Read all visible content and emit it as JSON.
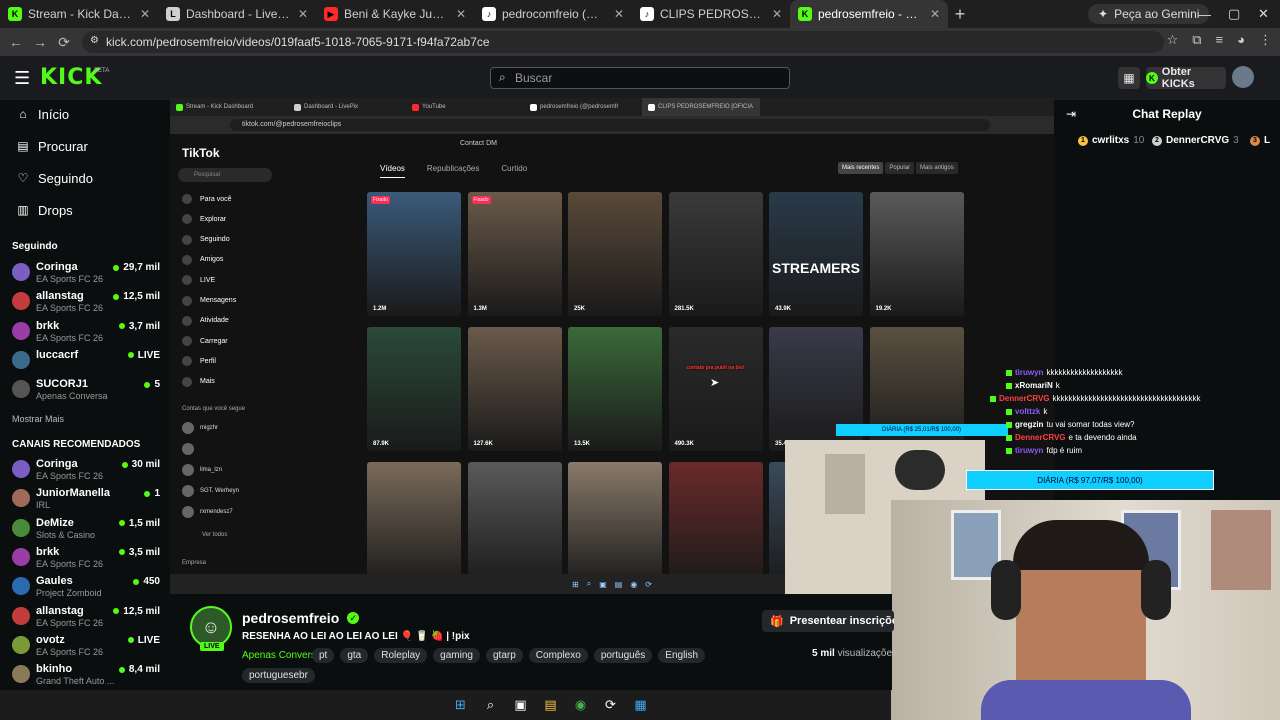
{
  "browser": {
    "tabs": [
      {
        "title": "Stream - Kick Dashboard",
        "fav": "K",
        "color": "#53fc18"
      },
      {
        "title": "Dashboard - LivePix",
        "fav": "L",
        "color": "#cfcfcf"
      },
      {
        "title": "Beni & Kayke Juan - \"Menor Pr",
        "fav": "▶",
        "color": "#ff2b2b"
      },
      {
        "title": "pedrocomfreio (@pedrocomfre",
        "fav": "♪",
        "color": "#ffffff"
      },
      {
        "title": "CLIPS PEDROSEMFREIO [OFICIA",
        "fav": "♪",
        "color": "#ffffff"
      },
      {
        "title": "pedrosemfreio - Watch the",
        "fav": "K",
        "color": "#53fc18"
      }
    ],
    "gemini_label": "Peça ao Gemini",
    "url": "kick.com/pedrosemfreio/videos/019faaf5-1018-7065-9171-f94fa72ab7ce"
  },
  "header": {
    "logo": "KICK",
    "beta": "BETA",
    "search_placeholder": "Buscar",
    "kicks_label": "Obter KICKs"
  },
  "sidebar": {
    "nav": [
      {
        "label": "Início",
        "icon": "⌂"
      },
      {
        "label": "Procurar",
        "icon": "▤"
      },
      {
        "label": "Seguindo",
        "icon": "♡"
      },
      {
        "label": "Drops",
        "icon": "▥"
      }
    ],
    "following_title": "Seguindo",
    "following": [
      {
        "name": "Coringa",
        "game": "EA Sports FC 26",
        "viewers": "29,7 mil",
        "color": "#7a5ec2"
      },
      {
        "name": "allanstag",
        "game": "EA Sports FC 26",
        "viewers": "12,5 mil",
        "color": "#c33b3b"
      },
      {
        "name": "brkk",
        "game": "EA Sports FC 26",
        "viewers": "3,7 mil",
        "color": "#9a3ca5"
      },
      {
        "name": "luccacrf",
        "game": "",
        "viewers": "LIVE",
        "color": "#3a6b8a"
      },
      {
        "name": "SUCORJ1",
        "game": "Apenas Conversa",
        "viewers": "5",
        "color": "#555555"
      }
    ],
    "show_more": "Mostrar Mais",
    "recommended_title": "CANAIS RECOMENDADOS",
    "recommended": [
      {
        "name": "Coringa",
        "game": "EA Sports FC 26",
        "viewers": "30 mil",
        "color": "#7a5ec2"
      },
      {
        "name": "JuniorManella",
        "game": "IRL",
        "viewers": "1",
        "color": "#a06a5a"
      },
      {
        "name": "DeMize",
        "game": "Slots & Casino",
        "viewers": "1,5 mil",
        "color": "#4a8a3a"
      },
      {
        "name": "brkk",
        "game": "EA Sports FC 26",
        "viewers": "3,5 mil",
        "color": "#9a3ca5"
      },
      {
        "name": "Gaules",
        "game": "Project Zomboid",
        "viewers": "450",
        "color": "#2a6ab0"
      },
      {
        "name": "allanstag",
        "game": "EA Sports FC 26",
        "viewers": "12,5 mil",
        "color": "#c33b3b"
      },
      {
        "name": "ovotz",
        "game": "EA Sports FC 26",
        "viewers": "LIVE",
        "color": "#7a9a3a"
      },
      {
        "name": "bkinho",
        "game": "Grand Theft Auto ...",
        "viewers": "8,4 mil",
        "color": "#8a7a5a"
      }
    ]
  },
  "video": {
    "inner_tabs": [
      "Stream - Kick Dashboard",
      "Dashboard - LivePix",
      "YouTube",
      "pedrosemfreio (@pedrosemfr",
      "CLIPS PEDROSEMFREIO [OFICIA"
    ],
    "inner_gemini": "Peça ao Gemini",
    "inner_url": "tiktok.com/@pedrosemfreioclips",
    "tiktok": {
      "logo": "TikTok",
      "search": "Pesquisar",
      "nav": [
        "Para você",
        "Explorar",
        "Seguindo",
        "Amigos",
        "LIVE",
        "Mensagens",
        "Atividade",
        "Carregar",
        "Perfil",
        "Mais"
      ],
      "following_title": "Contas que você segue",
      "accounts": [
        "migzhr",
        "",
        "lima_lzn",
        "SGT. Werheyn",
        "rxmendesz7"
      ],
      "see_all": "Ver todos",
      "company": "Empresa",
      "contact": "Contact DM",
      "tabs": [
        "Vídeos",
        "Republicações",
        "Curtido"
      ],
      "sort": [
        "Mais recentes",
        "Popular",
        "Mais antigos"
      ],
      "grid": [
        {
          "views": "1.2M",
          "pinned": "Fixado",
          "caption": "",
          "big": "",
          "bg": "#3a5a7a"
        },
        {
          "views": "1.3M",
          "pinned": "Fixado",
          "caption": "",
          "big": "",
          "bg": "#6a5a4a"
        },
        {
          "views": "25K",
          "pinned": "",
          "caption": "",
          "big": "",
          "bg": "#5a4a3a"
        },
        {
          "views": "281.5K",
          "pinned": "",
          "caption": "",
          "big": "",
          "bg": "#3a3a3a"
        },
        {
          "views": "43.9K",
          "pinned": "",
          "caption": "",
          "big": "STREAMERS",
          "bg": "#2a3a4a"
        },
        {
          "views": "19.2K",
          "pinned": "",
          "caption": "",
          "big": "",
          "bg": "#5a5a5a"
        },
        {
          "views": "87.9K",
          "pinned": "",
          "caption": "",
          "big": "",
          "bg": "#2a4a3a"
        },
        {
          "views": "127.6K",
          "pinned": "",
          "caption": "",
          "big": "",
          "bg": "#6a5a4a"
        },
        {
          "views": "13.5K",
          "pinned": "",
          "caption": "",
          "big": "",
          "bg": "#3a6a3a"
        },
        {
          "views": "490.3K",
          "pinned": "",
          "caption": "contato pra publi na bio!",
          "big": "",
          "bg": "#2a2a2a"
        },
        {
          "views": "35.4K",
          "pinned": "",
          "caption": "",
          "big": "",
          "bg": "#3a3a4a"
        },
        {
          "views": "111.7K",
          "pinned": "",
          "caption": "",
          "big": "",
          "bg": "#5a5040"
        },
        {
          "views": "",
          "pinned": "",
          "caption": "",
          "big": "",
          "bg": "#7a6a5a"
        },
        {
          "views": "",
          "pinned": "",
          "caption": "",
          "big": "",
          "bg": "#5a5a5a"
        },
        {
          "views": "",
          "pinned": "",
          "caption": "",
          "big": "",
          "bg": "#8a7a6a"
        },
        {
          "views": "",
          "pinned": "",
          "caption": "",
          "big": "",
          "bg": "#6a2a2a"
        },
        {
          "views": "",
          "pinned": "",
          "caption": "",
          "big": "RECIFE",
          "bg": "#3a4a5a"
        }
      ]
    }
  },
  "overlay": {
    "messages": [
      {
        "user": "tiruwyn",
        "text": "kkkkkkkkkkkkkkkkkkk",
        "color": "#8a5cf6"
      },
      {
        "user": "xRomariN",
        "text": "k",
        "color": "#ffffff"
      },
      {
        "user": "DennerCRVG",
        "text": "kkkkkkkkkkkkkkkkkkkkkkkkkkkkkkkkkkkkk",
        "color": "#ff4040"
      },
      {
        "user": "volttzk",
        "text": "k",
        "color": "#8a5cf6"
      },
      {
        "user": "gregzin",
        "text": "tu vai somar todas view?",
        "color": "#ffffff"
      },
      {
        "user": "DennerCRVG",
        "text": "e ta devendo ainda",
        "color": "#ff4040"
      },
      {
        "user": "tiruwyn",
        "text": "fdp é ruim",
        "color": "#8a5cf6"
      }
    ],
    "goal": "DIÁRIA (R$ 97,07/R$ 100,00)",
    "goal_small": "DIÁRIA (R$ 25,01/R$ 100,00)"
  },
  "chat": {
    "title": "Chat Replay",
    "gifters": [
      {
        "name": "cwrlitxs",
        "count": "10",
        "badge": "1",
        "color": "#f5c542"
      },
      {
        "name": "DennerCRVG",
        "count": "3",
        "badge": "2",
        "color": "#cfcfcf"
      },
      {
        "name": "L",
        "count": "",
        "badge": "3",
        "color": "#d98a4a"
      }
    ]
  },
  "stream": {
    "name": "pedrosemfreio",
    "title": "RESENHA AO LEI AO LEI AO LEI 🎈 🥛 🍓 | !pix",
    "category": "Apenas Conversa",
    "tags": [
      "pt",
      "gta",
      "Roleplay",
      "gaming",
      "gtarp",
      "Complexo",
      "português",
      "English"
    ],
    "tag_extra": "portuguesebr",
    "live_label": "LIVE",
    "gift_button": "Presentear inscrições",
    "viewers_count": "5 mil",
    "viewers_label": "visualizações"
  },
  "taskbar": [
    "⊞",
    "⌕",
    "▣",
    "▤",
    "◉",
    "⟳",
    "▦"
  ]
}
